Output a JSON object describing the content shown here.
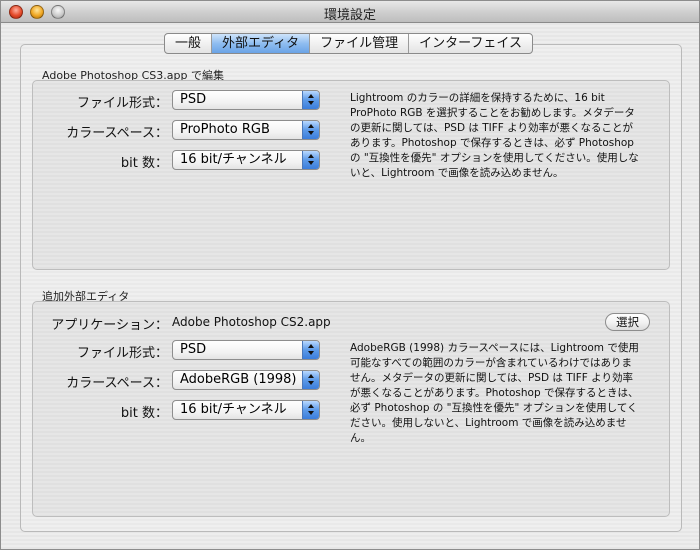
{
  "window": {
    "title": "環境設定"
  },
  "tabs": [
    {
      "label": "一般"
    },
    {
      "label": "外部エディタ"
    },
    {
      "label": "ファイル管理"
    },
    {
      "label": "インターフェイス"
    }
  ],
  "primary": {
    "group_title": "Adobe Photoshop CS3.app で編集",
    "file_format_label": "ファイル形式：",
    "file_format_value": "PSD",
    "color_space_label": "カラースペース：",
    "color_space_value": "ProPhoto RGB",
    "bit_depth_label": "bit 数：",
    "bit_depth_value": "16 bit/チャンネル",
    "description_lines": [
      "Lightroom のカラーの詳細を保持するために、16 bit",
      "ProPhoto RGB を選択することをお勧めします。メタデータ",
      "の更新に関しては、PSD は TIFF より効率が悪くなることが",
      "あります。Photoshop で保存するときは、必ず Photoshop",
      "の \"互換性を優先\" オプションを使用してください。使用しな",
      "いと、Lightroom で画像を読み込めません。"
    ]
  },
  "additional": {
    "group_title": "追加外部エディタ",
    "application_label": "アプリケーション：",
    "application_value": "Adobe Photoshop CS2.app",
    "choose_button": "選択",
    "file_format_label": "ファイル形式：",
    "file_format_value": "PSD",
    "color_space_label": "カラースペース：",
    "color_space_value": "AdobeRGB (1998)",
    "bit_depth_label": "bit 数：",
    "bit_depth_value": "16 bit/チャンネル",
    "description_lines": [
      "AdobeRGB (1998) カラースペースには、Lightroom で使用",
      "可能なすべての範囲のカラーが含まれているわけではありま",
      "せん。メタデータの更新に関しては、PSD は TIFF より効率",
      "が悪くなることがあります。Photoshop で保存するときは、",
      "必ず Photoshop の \"互換性を優先\" オプションを使用してく",
      "ださい。使用しないと、Lightroom で画像を読み込めませ",
      "ん。"
    ]
  }
}
